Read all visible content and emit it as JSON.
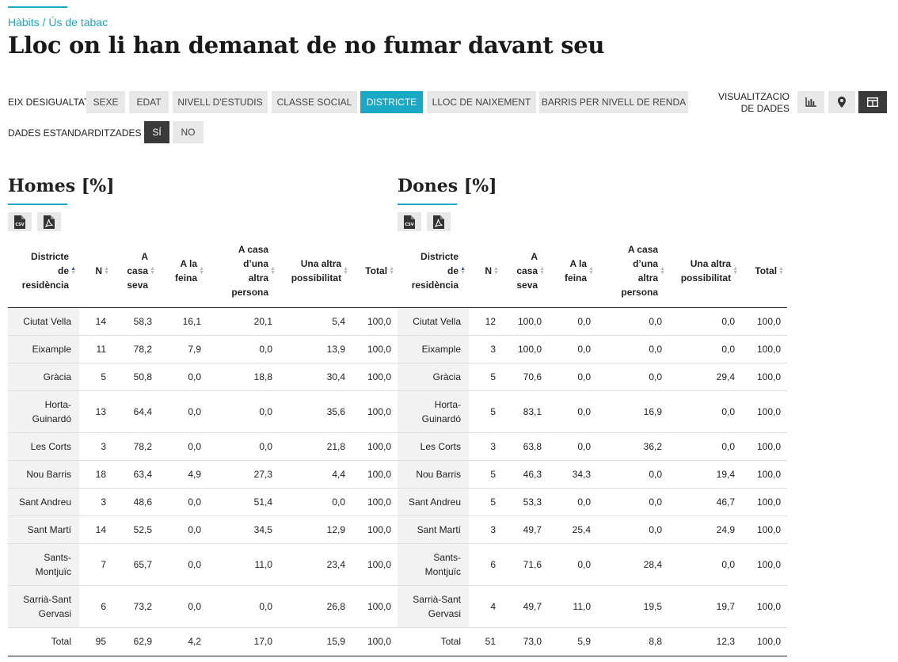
{
  "breadcrumb": {
    "parent": "Hàbits",
    "separator": " / ",
    "current": "Ús de tabac"
  },
  "title": "Lloc on li han demanat de no fumar davant seu",
  "axis": {
    "label": "EIX DESIGUALTAT",
    "options": [
      "SEXE",
      "EDAT",
      "NIVELL D'ESTUDIS",
      "CLASSE SOCIAL",
      "DISTRICTE",
      "LLOC DE NAIXEMENT",
      "BARRIS PER NIVELL DE RENDA"
    ],
    "selected": "DISTRICTE"
  },
  "standardized": {
    "label": "DADES ESTANDARDITZADES",
    "yes": "SÍ",
    "no": "NO",
    "selected": "SÍ"
  },
  "visualization": {
    "label_line1": "VISUALITZACIO",
    "label_line2": "DE DADES",
    "icons": [
      "bar-chart-icon",
      "map-pin-icon",
      "table-icon"
    ],
    "selected": "table-icon"
  },
  "colors": {
    "accent": "#1aa9c4",
    "dark": "#3a3a3a",
    "sort_active": "#3b4ccf"
  },
  "headers": {
    "district": [
      "Districte",
      "de",
      "residència"
    ],
    "n": [
      "N"
    ],
    "home": [
      "A",
      "casa",
      "seva"
    ],
    "work": [
      "A la",
      "feina"
    ],
    "other_home": [
      "A casa",
      "d’una",
      "altra",
      "persona"
    ],
    "other": [
      "Una altra",
      "possibilitat"
    ],
    "total": [
      "Total"
    ]
  },
  "men": {
    "title": "Homes [%]",
    "rows": [
      {
        "district": [
          "Ciutat Vella"
        ],
        "n": "14",
        "home": "58,3",
        "work": "16,1",
        "other_home": "20,1",
        "other": "5,4",
        "total": "100,0"
      },
      {
        "district": [
          "Eixample"
        ],
        "n": "11",
        "home": "78,2",
        "work": "7,9",
        "other_home": "0,0",
        "other": "13,9",
        "total": "100,0"
      },
      {
        "district": [
          "Gràcia"
        ],
        "n": "5",
        "home": "50,8",
        "work": "0,0",
        "other_home": "18,8",
        "other": "30,4",
        "total": "100,0"
      },
      {
        "district": [
          "Horta-",
          "Guinardó"
        ],
        "n": "13",
        "home": "64,4",
        "work": "0,0",
        "other_home": "0,0",
        "other": "35,6",
        "total": "100,0"
      },
      {
        "district": [
          "Les Corts"
        ],
        "n": "3",
        "home": "78,2",
        "work": "0,0",
        "other_home": "0,0",
        "other": "21,8",
        "total": "100,0"
      },
      {
        "district": [
          "Nou Barris"
        ],
        "n": "18",
        "home": "63,4",
        "work": "4,9",
        "other_home": "27,3",
        "other": "4,4",
        "total": "100,0"
      },
      {
        "district": [
          "Sant Andreu"
        ],
        "n": "3",
        "home": "48,6",
        "work": "0,0",
        "other_home": "51,4",
        "other": "0,0",
        "total": "100,0"
      },
      {
        "district": [
          "Sant Martí"
        ],
        "n": "14",
        "home": "52,5",
        "work": "0,0",
        "other_home": "34,5",
        "other": "12,9",
        "total": "100,0"
      },
      {
        "district": [
          "Sants-",
          "Montjuïc"
        ],
        "n": "7",
        "home": "65,7",
        "work": "0,0",
        "other_home": "11,0",
        "other": "23,4",
        "total": "100,0"
      },
      {
        "district": [
          "Sarrià-Sant",
          "Gervasi"
        ],
        "n": "6",
        "home": "73,2",
        "work": "0,0",
        "other_home": "0,0",
        "other": "26,8",
        "total": "100,0"
      }
    ],
    "total_row": {
      "district": [
        "Total"
      ],
      "n": "95",
      "home": "62,9",
      "work": "4,2",
      "other_home": "17,0",
      "other": "15,9",
      "total": "100,0"
    }
  },
  "women": {
    "title": "Dones [%]",
    "rows": [
      {
        "district": [
          "Ciutat Vella"
        ],
        "n": "12",
        "home": "100,0",
        "work": "0,0",
        "other_home": "0,0",
        "other": "0,0",
        "total": "100,0"
      },
      {
        "district": [
          "Eixample"
        ],
        "n": "3",
        "home": "100,0",
        "work": "0,0",
        "other_home": "0,0",
        "other": "0,0",
        "total": "100,0"
      },
      {
        "district": [
          "Gràcia"
        ],
        "n": "5",
        "home": "70,6",
        "work": "0,0",
        "other_home": "0,0",
        "other": "29,4",
        "total": "100,0"
      },
      {
        "district": [
          "Horta-",
          "Guinardó"
        ],
        "n": "5",
        "home": "83,1",
        "work": "0,0",
        "other_home": "16,9",
        "other": "0,0",
        "total": "100,0"
      },
      {
        "district": [
          "Les Corts"
        ],
        "n": "3",
        "home": "63,8",
        "work": "0,0",
        "other_home": "36,2",
        "other": "0,0",
        "total": "100,0"
      },
      {
        "district": [
          "Nou Barris"
        ],
        "n": "5",
        "home": "46,3",
        "work": "34,3",
        "other_home": "0,0",
        "other": "19,4",
        "total": "100,0"
      },
      {
        "district": [
          "Sant Andreu"
        ],
        "n": "5",
        "home": "53,3",
        "work": "0,0",
        "other_home": "0,0",
        "other": "46,7",
        "total": "100,0"
      },
      {
        "district": [
          "Sant Martí"
        ],
        "n": "3",
        "home": "49,7",
        "work": "25,4",
        "other_home": "0,0",
        "other": "24,9",
        "total": "100,0"
      },
      {
        "district": [
          "Sants-",
          "Montjuïc"
        ],
        "n": "6",
        "home": "71,6",
        "work": "0,0",
        "other_home": "28,4",
        "other": "0,0",
        "total": "100,0"
      },
      {
        "district": [
          "Sarrià-Sant",
          "Gervasi"
        ],
        "n": "4",
        "home": "49,7",
        "work": "11,0",
        "other_home": "19,5",
        "other": "19,7",
        "total": "100,0"
      }
    ],
    "total_row": {
      "district": [
        "Total"
      ],
      "n": "51",
      "home": "73,0",
      "work": "5,9",
      "other_home": "8,8",
      "other": "12,3",
      "total": "100,0"
    }
  }
}
